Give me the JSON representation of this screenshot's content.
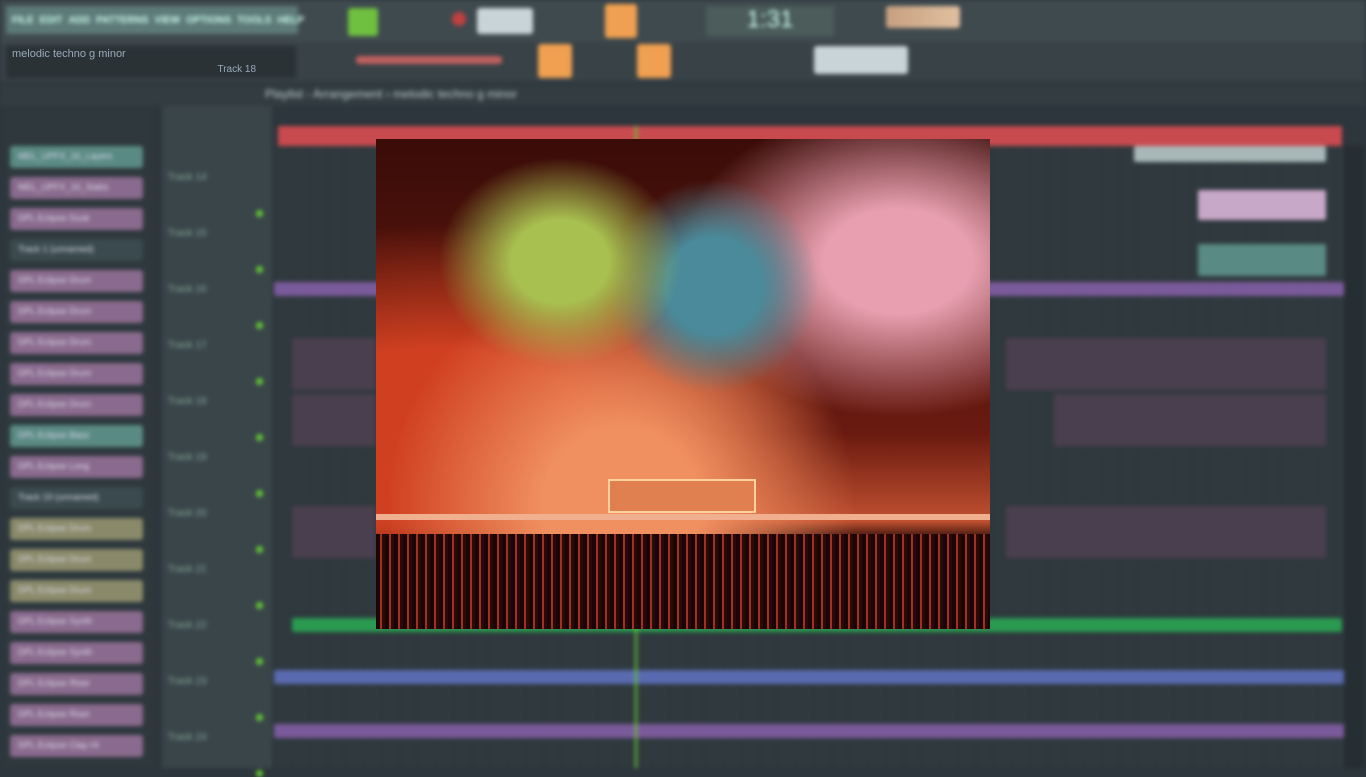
{
  "menu": [
    "FILE",
    "EDIT",
    "ADD",
    "PATTERNS",
    "VIEW",
    "OPTIONS",
    "TOOLS",
    "HELP"
  ],
  "song": {
    "title": "melodic techno g minor",
    "sub": "Track 18"
  },
  "time": "1:31",
  "playlist": {
    "breadcrumb": "Playlist - Arrangement › melodic techno g minor"
  },
  "channels": [
    {
      "label": "MEL_UPFX_16_Layers",
      "color": "#5a8a84"
    },
    {
      "label": "MEL_UPFX_16_Stabs",
      "color": "#8a6a8e"
    },
    {
      "label": "DPL Eclipse Dusk",
      "color": "#8a6a8e"
    },
    {
      "label": "Track 1 (unnamed)",
      "color": "#3a4a4e"
    },
    {
      "label": "DPL Eclipse Drum",
      "color": "#8a6a8e"
    },
    {
      "label": "DPL Eclipse Drum",
      "color": "#8a6a8e"
    },
    {
      "label": "DPL Eclipse Drum",
      "color": "#8a6a8e"
    },
    {
      "label": "DPL Eclipse Drum",
      "color": "#8a6a8e"
    },
    {
      "label": "DPL Eclipse Drum",
      "color": "#8a6a8e"
    },
    {
      "label": "DPL Eclipse Bass",
      "color": "#5a8a84"
    },
    {
      "label": "DPL Eclipse Long",
      "color": "#8a6a8e"
    },
    {
      "label": "Track 19 (unnamed)",
      "color": "#3a4a4e"
    },
    {
      "label": "DPL Eclipse Drum",
      "color": "#8a8a6a"
    },
    {
      "label": "DPL Eclipse Drum",
      "color": "#8a8a6a"
    },
    {
      "label": "DPL Eclipse Drum",
      "color": "#8a8a6a"
    },
    {
      "label": "DPL Eclipse Synth",
      "color": "#8a6a8e"
    },
    {
      "label": "DPL Eclipse Synth",
      "color": "#8a6a8e"
    },
    {
      "label": "DPL Eclipse Riser",
      "color": "#8a6a8e"
    },
    {
      "label": "DPL Eclipse Riser",
      "color": "#8a6a8e"
    },
    {
      "label": "DPL Eclipse Clap Hi",
      "color": "#8a6a8e"
    }
  ],
  "tracks": [
    "Track 14",
    "Track 15",
    "Track 16",
    "Track 17",
    "Track 18",
    "Track 19",
    "Track 20",
    "Track 21",
    "Track 22",
    "Track 23",
    "Track 24"
  ]
}
